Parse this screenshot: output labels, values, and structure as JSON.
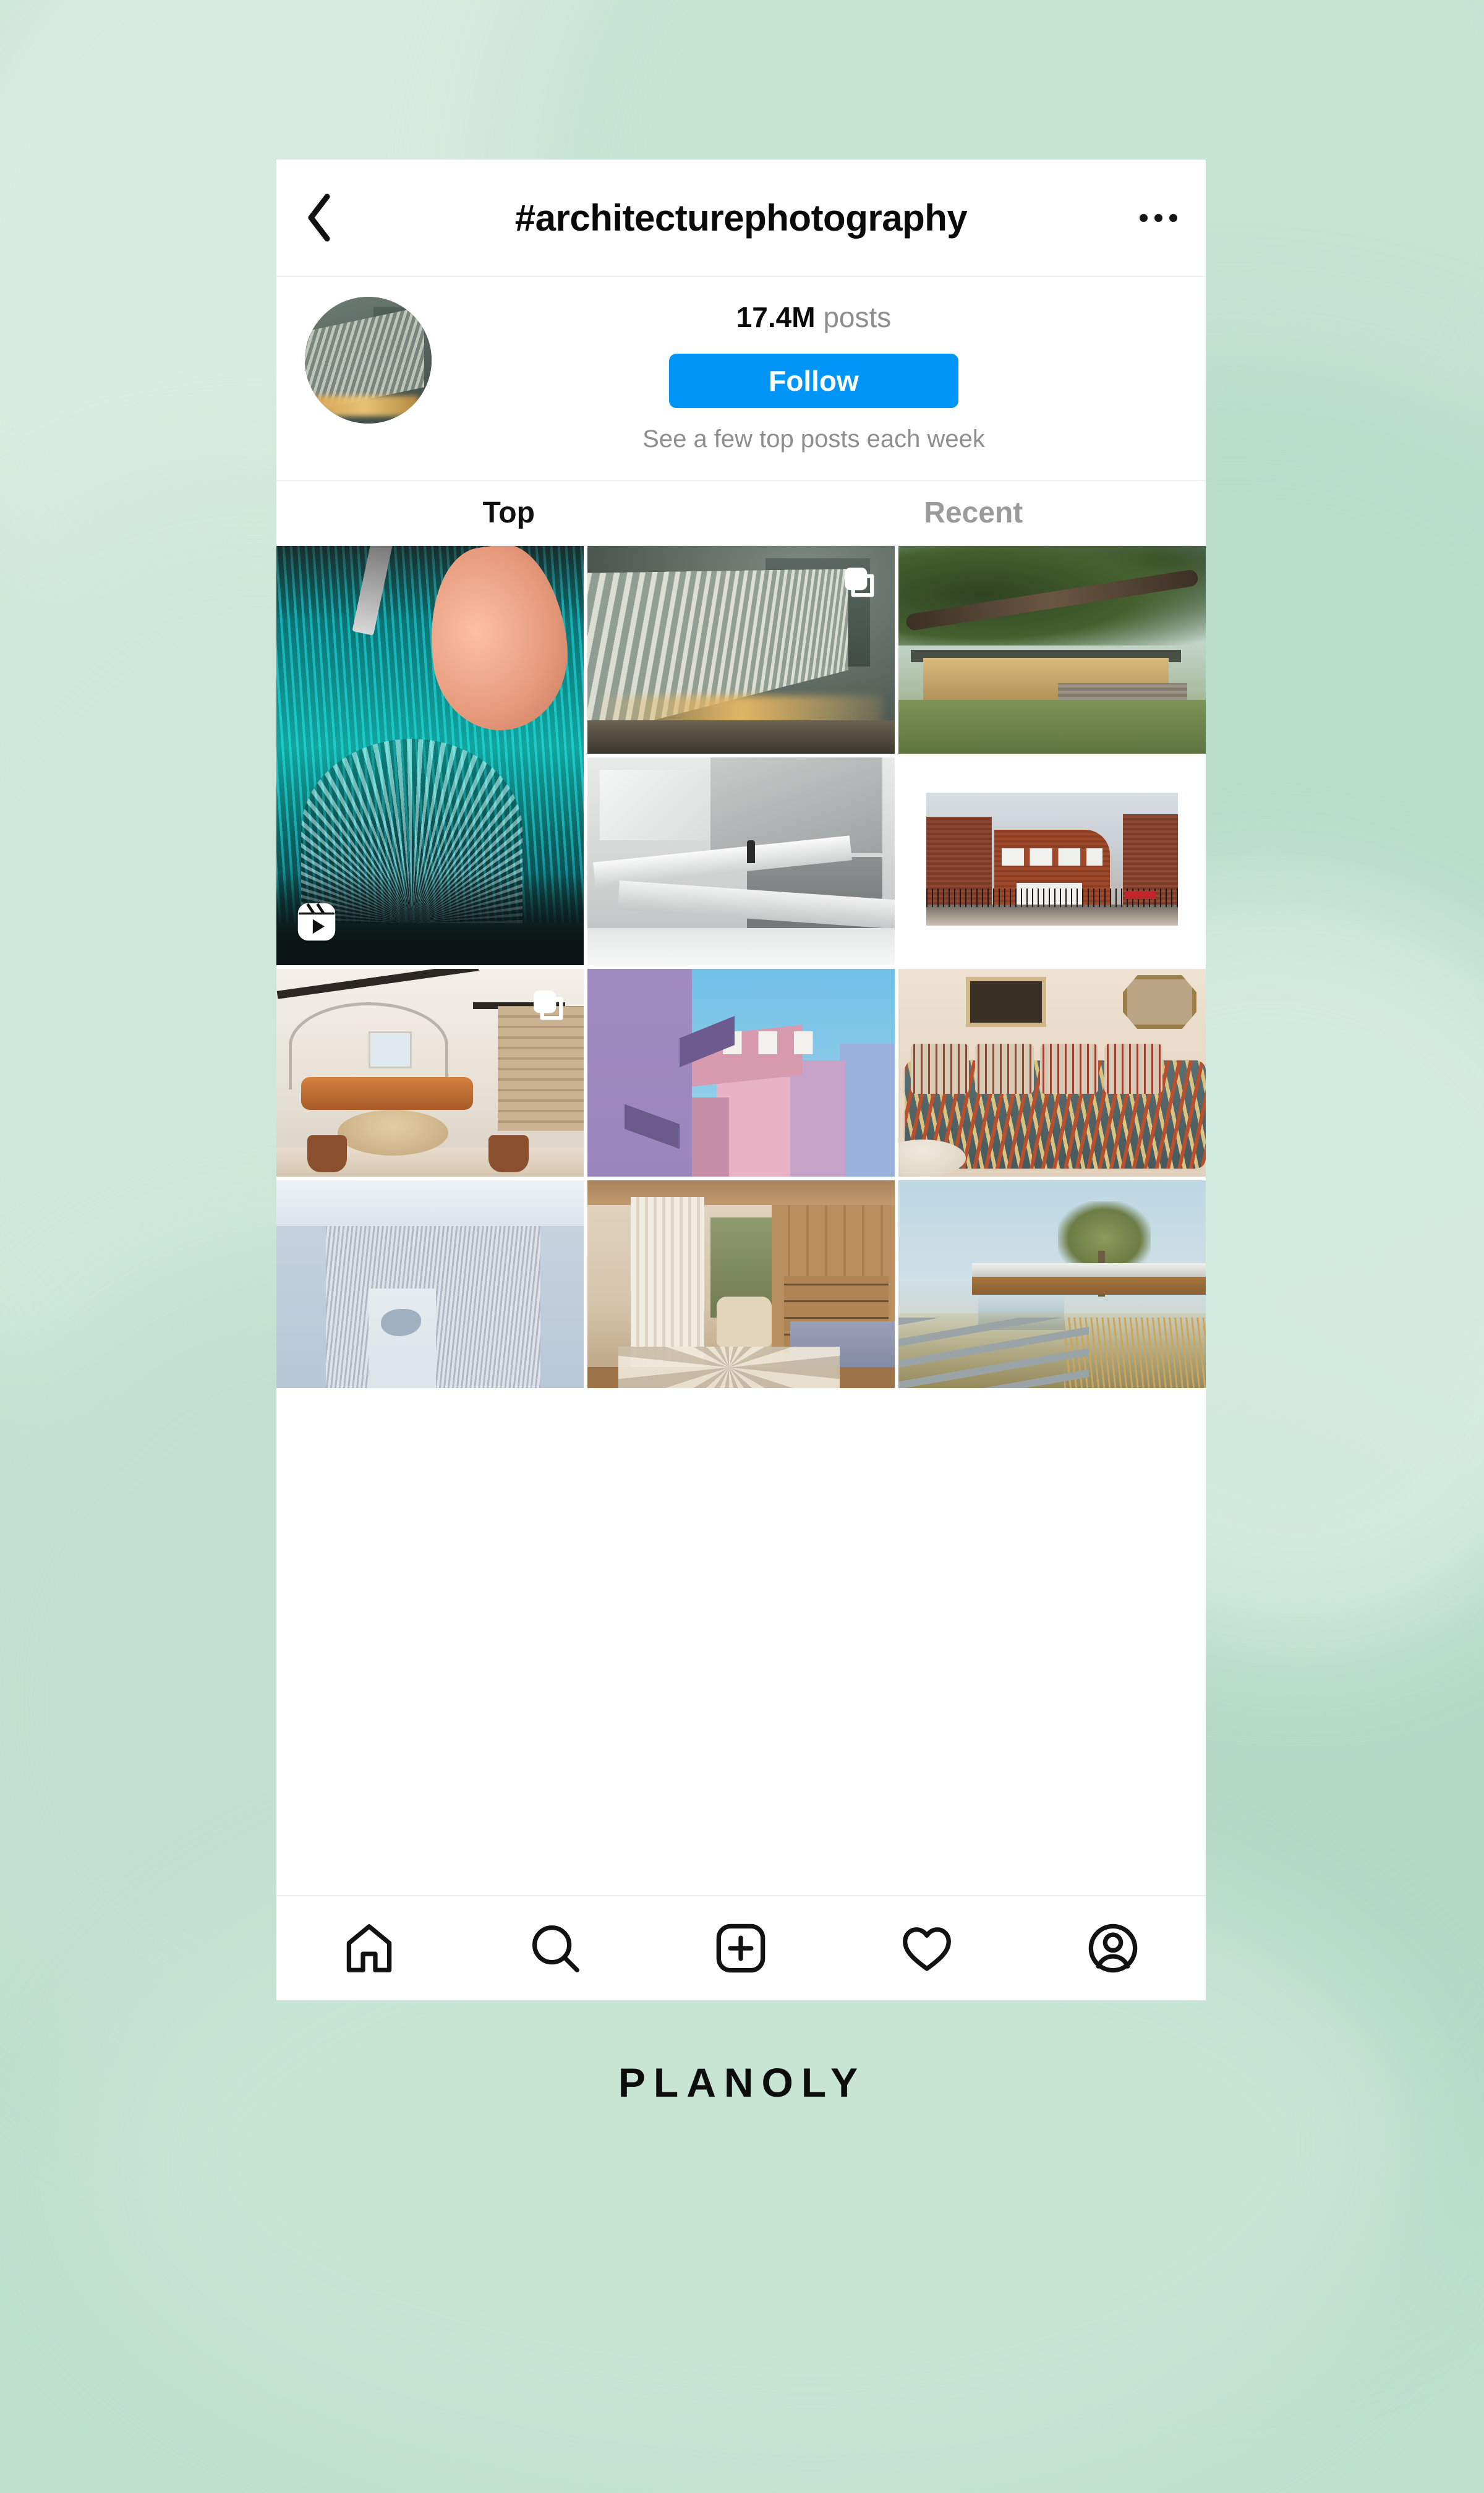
{
  "theme": {
    "background_color": "#bfe0cf",
    "card_color": "#ffffff",
    "accent_color": "#0095f6",
    "text_primary": "#0a0a0a",
    "text_secondary": "#8e8e8e",
    "divider_color": "#efefef"
  },
  "header": {
    "back_icon": "chevron-left-icon",
    "title": "#architecturephotography",
    "more_icon": "more-options-icon"
  },
  "profile": {
    "avatar_icon": "hashtag-avatar",
    "posts_count": "17.4M",
    "posts_label": "posts",
    "follow_label": "Follow",
    "subtitle": "See a few top posts each week"
  },
  "tabs": [
    {
      "label": "Top",
      "active": true
    },
    {
      "label": "Recent",
      "active": false
    }
  ],
  "grid": {
    "columns": 3,
    "posts": [
      {
        "name": "teal-paper-art-reel",
        "media_type": "reel",
        "badge_icon": "reels-icon",
        "span_rows": 2
      },
      {
        "name": "louvered-facade-dusk",
        "media_type": "carousel",
        "badge_icon": "carousel-icon",
        "span_rows": 1
      },
      {
        "name": "oak-tree-modern-house",
        "media_type": "photo",
        "badge_icon": null,
        "span_rows": 1
      },
      {
        "name": "concrete-stair-architecture",
        "media_type": "photo",
        "badge_icon": null,
        "span_rows": 1
      },
      {
        "name": "brick-building-white-frame",
        "media_type": "photo",
        "badge_icon": null,
        "span_rows": 1
      },
      {
        "name": "attic-living-room",
        "media_type": "carousel",
        "badge_icon": "carousel-icon",
        "span_rows": 1
      },
      {
        "name": "pastel-postmodern-building",
        "media_type": "photo",
        "badge_icon": null,
        "span_rows": 1
      },
      {
        "name": "ikat-sofa-living-room",
        "media_type": "photo",
        "badge_icon": null,
        "span_rows": 1
      },
      {
        "name": "aerial-snowy-manhattan",
        "media_type": "photo",
        "badge_icon": null,
        "span_rows": 1
      },
      {
        "name": "wood-bedroom-curtain",
        "media_type": "photo",
        "badge_icon": null,
        "span_rows": 1
      },
      {
        "name": "cantilever-house-tree",
        "media_type": "photo",
        "badge_icon": null,
        "span_rows": 1
      }
    ]
  },
  "bottom_nav": [
    {
      "name": "home-icon",
      "label": "Home"
    },
    {
      "name": "search-icon",
      "label": "Search"
    },
    {
      "name": "add-post-icon",
      "label": "Create"
    },
    {
      "name": "heart-icon",
      "label": "Activity"
    },
    {
      "name": "profile-icon",
      "label": "Profile"
    }
  ],
  "branding": {
    "wordmark": "PLANOLY"
  }
}
